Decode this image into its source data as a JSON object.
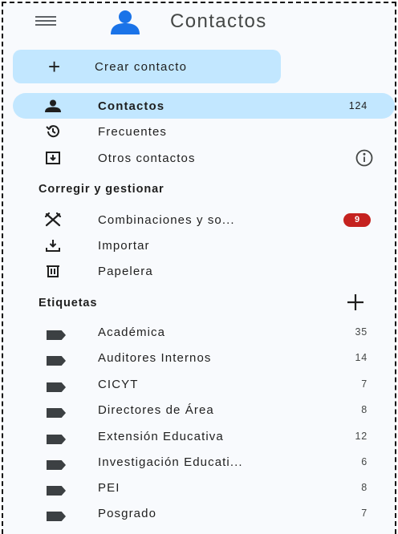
{
  "header": {
    "title": "Contactos",
    "menu_icon": "hamburger-menu-icon",
    "logo_icon": "contacts-person-logo",
    "brand_color": "#1a73e8"
  },
  "create_button": {
    "label": "Crear contacto",
    "icon": "plus-icon"
  },
  "nav": {
    "items": [
      {
        "label": "Contactos",
        "count": "124",
        "icon": "person-icon",
        "active": true
      },
      {
        "label": "Frecuentes",
        "icon": "history-icon"
      },
      {
        "label": "Otros contactos",
        "icon": "download-box-icon",
        "info_icon": "info-icon"
      }
    ]
  },
  "manage": {
    "title": "Corregir y gestionar",
    "items": [
      {
        "label": "Combinaciones y so...",
        "badge": "9",
        "icon": "tools-icon",
        "badge_color": "#c5221f"
      },
      {
        "label": "Importar",
        "icon": "import-icon"
      },
      {
        "label": "Papelera",
        "icon": "trash-icon"
      }
    ]
  },
  "labels": {
    "title": "Etiquetas",
    "add_icon": "plus-icon",
    "items": [
      {
        "label": "Académica",
        "count": "35"
      },
      {
        "label": "Auditores Internos",
        "count": "14"
      },
      {
        "label": "CICYT",
        "count": "7"
      },
      {
        "label": "Directores de Área",
        "count": "8"
      },
      {
        "label": "Extensión Educativa",
        "count": "12"
      },
      {
        "label": "Investigación Educati...",
        "count": "6"
      },
      {
        "label": "PEI",
        "count": "8"
      },
      {
        "label": "Posgrado",
        "count": "7"
      }
    ]
  },
  "colors": {
    "active_bg": "#c2e7ff",
    "sidebar_bg": "#f8fafd"
  }
}
